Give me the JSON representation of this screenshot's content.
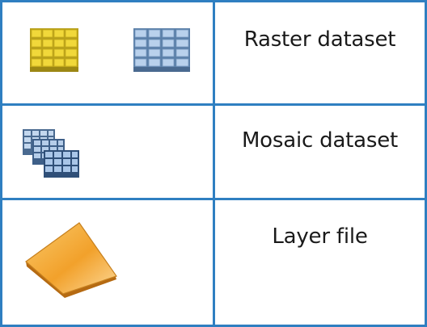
{
  "rows": [
    {
      "label": "Raster dataset",
      "icons": [
        "raster-dataset-yellow-icon",
        "raster-dataset-blue-icon"
      ]
    },
    {
      "label": "Mosaic dataset",
      "icons": [
        "mosaic-dataset-icon"
      ]
    },
    {
      "label": "Layer file",
      "icons": [
        "layer-file-icon"
      ]
    }
  ],
  "colors": {
    "grid_line": "#2f7fc1",
    "raster_yellow": "#e8cc2a",
    "raster_blue": "#7fa9d6",
    "layer_orange": "#f3a633"
  }
}
